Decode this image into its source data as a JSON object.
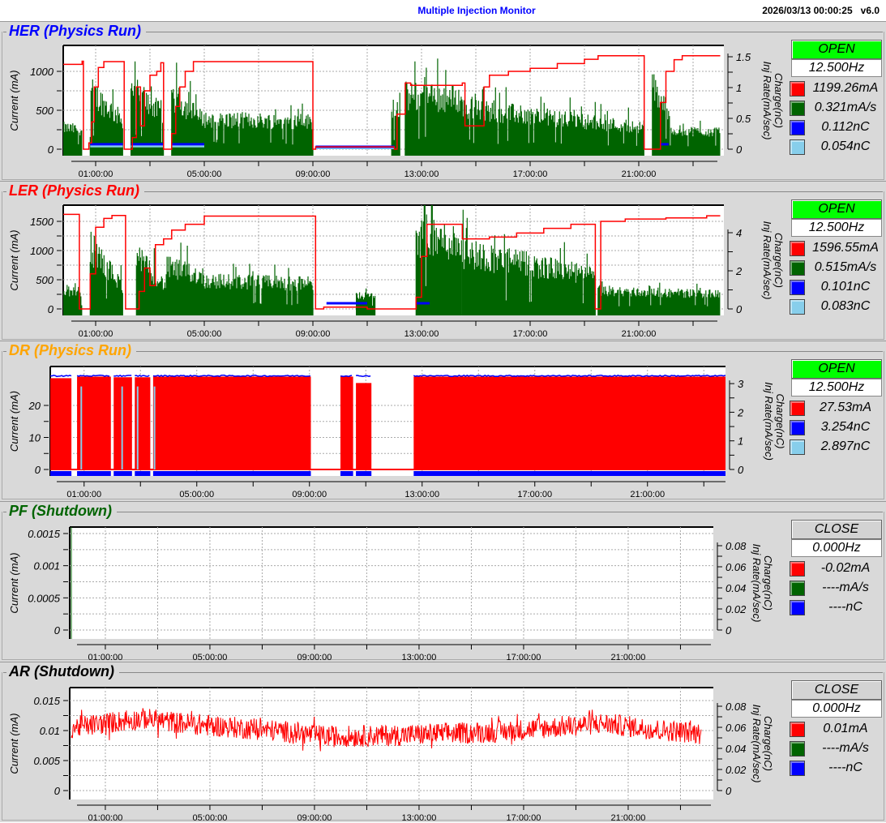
{
  "header": {
    "title": "Multiple Injection Monitor",
    "timestamp": "2026/03/13 00:00:25",
    "version": "v6.0"
  },
  "axis_labels": {
    "left": "Current (mA)",
    "right_charge": "Charge(nC)",
    "right_rate": "Inj Rate(mA/sec)"
  },
  "time_ticks": [
    "01:00:00",
    "05:00:00",
    "09:00:00",
    "13:00:00",
    "17:00:00",
    "21:00:00"
  ],
  "colors": {
    "current": "#ff0000",
    "inj_rate": "#006400",
    "charge1": "#0000ff",
    "charge2": "#87ceeb",
    "open": "#00ff00",
    "close": "#d3d3d3"
  },
  "panels": [
    {
      "id": "HER",
      "title": "HER  (Physics Run)",
      "title_color": "#0000ff",
      "status": "OPEN",
      "rate": "12.500Hz",
      "legend": [
        {
          "color": "#ff0000",
          "value": "1199.26mA"
        },
        {
          "color": "#006400",
          "value": "0.321mA/s"
        },
        {
          "color": "#0000ff",
          "value": "0.112nC"
        },
        {
          "color": "#87ceeb",
          "value": "0.054nC"
        }
      ]
    },
    {
      "id": "LER",
      "title": "LER  (Physics Run)",
      "title_color": "#ff0000",
      "status": "OPEN",
      "rate": "12.500Hz",
      "legend": [
        {
          "color": "#ff0000",
          "value": "1596.55mA"
        },
        {
          "color": "#006400",
          "value": "0.515mA/s"
        },
        {
          "color": "#0000ff",
          "value": "0.101nC"
        },
        {
          "color": "#87ceeb",
          "value": "0.083nC"
        }
      ]
    },
    {
      "id": "DR",
      "title": "DR  (Physics Run)",
      "title_color": "#ffa500",
      "status": "OPEN",
      "rate": "12.500Hz",
      "legend": [
        {
          "color": "#ff0000",
          "value": "27.53mA"
        },
        {
          "color": "#0000ff",
          "value": "3.254nC"
        },
        {
          "color": "#87ceeb",
          "value": "2.897nC"
        }
      ]
    },
    {
      "id": "PF",
      "title": "PF  (Shutdown)",
      "title_color": "#006400",
      "status": "CLOSE",
      "rate": "0.000Hz",
      "legend": [
        {
          "color": "#ff0000",
          "value": "-0.02mA"
        },
        {
          "color": "#006400",
          "value": "----mA/s"
        },
        {
          "color": "#0000ff",
          "value": "----nC"
        }
      ]
    },
    {
      "id": "AR",
      "title": "AR  (Shutdown)",
      "title_color": "#000000",
      "status": "CLOSE",
      "rate": "0.000Hz",
      "legend": [
        {
          "color": "#ff0000",
          "value": "0.01mA"
        },
        {
          "color": "#006400",
          "value": "----mA/s"
        },
        {
          "color": "#0000ff",
          "value": "----nC"
        }
      ]
    }
  ],
  "chart_data": [
    {
      "id": "HER",
      "type": "line",
      "x_unit": "hours",
      "xlim": [
        -0.2,
        24
      ],
      "left_ticks": [
        "0",
        "500",
        "1000"
      ],
      "left_tick_values": [
        0,
        500,
        1000
      ],
      "left_minor": 250,
      "right_ticks": [
        "0",
        "0.5",
        "1",
        "1.5"
      ],
      "right_tick_values": [
        0,
        0.5,
        1,
        1.5
      ],
      "right_minor": 0.25,
      "current_steps": [
        [
          -0.2,
          1090
        ],
        [
          0.5,
          1130
        ],
        [
          0.55,
          0
        ],
        [
          0.75,
          80
        ],
        [
          0.85,
          350
        ],
        [
          0.95,
          800
        ],
        [
          1.1,
          1050
        ],
        [
          1.3,
          1125
        ],
        [
          2.05,
          0
        ],
        [
          2.35,
          150
        ],
        [
          2.5,
          800
        ],
        [
          2.65,
          300
        ],
        [
          2.8,
          750
        ],
        [
          3.0,
          950
        ],
        [
          3.25,
          1000
        ],
        [
          3.4,
          1110
        ],
        [
          3.5,
          0
        ],
        [
          3.8,
          200
        ],
        [
          3.95,
          550
        ],
        [
          4.1,
          800
        ],
        [
          4.3,
          1000
        ],
        [
          4.6,
          1125
        ],
        [
          9.0,
          0
        ],
        [
          9.1,
          30
        ],
        [
          12.0,
          0
        ],
        [
          12.1,
          450
        ],
        [
          12.4,
          850
        ],
        [
          12.6,
          820
        ],
        [
          14.5,
          850
        ],
        [
          14.6,
          300
        ],
        [
          15.3,
          800
        ],
        [
          15.5,
          950
        ],
        [
          16.2,
          1000
        ],
        [
          17.0,
          1040
        ],
        [
          18.0,
          1100
        ],
        [
          19.0,
          1155
        ],
        [
          19.5,
          1200
        ],
        [
          21.2,
          0
        ],
        [
          21.8,
          600
        ],
        [
          22.0,
          1000
        ],
        [
          22.3,
          1150
        ],
        [
          22.6,
          1200
        ],
        [
          24,
          1200
        ]
      ],
      "inj_rate_segments": [
        [
          -0.2,
          0.5,
          0.45,
          0.4
        ],
        [
          0.8,
          2.0,
          1.2,
          0.6
        ],
        [
          2.3,
          3.5,
          1.3,
          0.7
        ],
        [
          3.8,
          5.0,
          1.1,
          0.6
        ],
        [
          5.0,
          9.0,
          0.62,
          0.58
        ],
        [
          11.9,
          12.2,
          0.9,
          0.9
        ],
        [
          12.4,
          14.5,
          1.1,
          1.05
        ],
        [
          14.5,
          21.2,
          0.85,
          0.45
        ],
        [
          21.5,
          22.1,
          1.3,
          0.8
        ],
        [
          22.1,
          24,
          0.4,
          0.35
        ]
      ],
      "charge1_segments": [
        [
          0.8,
          2.0,
          0.08
        ],
        [
          2.3,
          3.5,
          0.08
        ],
        [
          3.8,
          5.0,
          0.08
        ],
        [
          9.1,
          12.0,
          0.04
        ],
        [
          21.8,
          22.1,
          0.08
        ]
      ],
      "charge2_segments": [
        [
          0.8,
          2.0,
          0.05
        ],
        [
          2.3,
          3.5,
          0.05
        ],
        [
          3.8,
          5.0,
          0.05
        ],
        [
          9.1,
          12.0,
          0.02
        ]
      ]
    },
    {
      "id": "LER",
      "type": "line",
      "x_unit": "hours",
      "xlim": [
        -0.2,
        24
      ],
      "left_ticks": [
        "0",
        "500",
        "1000",
        "1500"
      ],
      "left_tick_values": [
        0,
        500,
        1000,
        1500
      ],
      "left_minor": 250,
      "right_ticks": [
        "0",
        "2",
        "4"
      ],
      "right_tick_values": [
        0,
        2,
        4
      ],
      "right_minor": 1,
      "current_steps": [
        [
          -0.2,
          1620
        ],
        [
          0.4,
          0
        ],
        [
          0.8,
          600
        ],
        [
          1.0,
          1400
        ],
        [
          1.3,
          1550
        ],
        [
          1.6,
          1600
        ],
        [
          2.1,
          0
        ],
        [
          2.6,
          300
        ],
        [
          2.8,
          700
        ],
        [
          3.0,
          400
        ],
        [
          3.2,
          1100
        ],
        [
          3.5,
          1200
        ],
        [
          3.8,
          1350
        ],
        [
          4.3,
          1450
        ],
        [
          5.0,
          1590
        ],
        [
          9.1,
          0
        ],
        [
          9.4,
          30
        ],
        [
          11.0,
          0
        ],
        [
          12.8,
          200
        ],
        [
          13.0,
          900
        ],
        [
          13.2,
          1450
        ],
        [
          14.5,
          1200
        ],
        [
          15.5,
          1230
        ],
        [
          16.5,
          1300
        ],
        [
          17.5,
          1380
        ],
        [
          18.5,
          1450
        ],
        [
          19.4,
          0
        ],
        [
          19.6,
          1500
        ],
        [
          20.5,
          1540
        ],
        [
          22,
          1560
        ],
        [
          23.5,
          1596
        ],
        [
          24,
          1596
        ]
      ],
      "inj_rate_segments": [
        [
          -0.2,
          0.5,
          1.3,
          1.0
        ],
        [
          0.8,
          2.0,
          4.2,
          1.5
        ],
        [
          2.5,
          3.6,
          3.5,
          1.5
        ],
        [
          3.6,
          5.0,
          2.8,
          2.2
        ],
        [
          5.0,
          9.0,
          1.9,
          1.7
        ],
        [
          10.6,
          11.3,
          0.9,
          0.9
        ],
        [
          12.8,
          14.5,
          4.8,
          4.5
        ],
        [
          14.5,
          19.4,
          3.8,
          2.2
        ],
        [
          19.5,
          24,
          1.2,
          1.0
        ]
      ],
      "charge1_segments": [
        [
          9.5,
          11.0,
          0.3
        ],
        [
          12.8,
          13.3,
          0.3
        ]
      ],
      "charge2_segments": []
    },
    {
      "id": "DR",
      "type": "area",
      "x_unit": "hours",
      "xlim": [
        -0.2,
        24
      ],
      "left_ticks": [
        "0",
        "10",
        "20"
      ],
      "left_tick_values": [
        0,
        10,
        20
      ],
      "left_minor": 5,
      "right_ticks": [
        "0",
        "1",
        "2",
        "3"
      ],
      "right_tick_values": [
        0,
        1,
        2,
        3
      ],
      "right_minor": 0.5,
      "current_fill_segments": [
        [
          -0.2,
          0.55,
          28.5
        ],
        [
          0.75,
          1.95,
          29
        ],
        [
          2.05,
          2.7,
          28.8
        ],
        [
          2.8,
          3.35,
          28.8
        ],
        [
          3.45,
          9.05,
          29
        ],
        [
          10.1,
          10.55,
          29
        ],
        [
          10.65,
          11.2,
          27
        ],
        [
          12.7,
          24,
          29
        ]
      ],
      "charge1_top": 3.25,
      "charge2_top": 2.9
    },
    {
      "id": "PF",
      "type": "line",
      "x_unit": "hours",
      "xlim": [
        -0.3,
        24
      ],
      "left_ticks": [
        "0",
        "0.0005",
        "0.001",
        "0.0015"
      ],
      "left_tick_values": [
        0,
        0.0005,
        0.001,
        0.0015
      ],
      "left_minor": 0.00025,
      "right_ticks": [
        "0",
        "0.02",
        "0.04",
        "0.06",
        "0.08"
      ],
      "right_tick_values": [
        0,
        0.02,
        0.04,
        0.06,
        0.08
      ],
      "right_minor": 0.01,
      "noise_baseline": []
    },
    {
      "id": "AR",
      "type": "line",
      "x_unit": "hours",
      "xlim": [
        -0.3,
        24
      ],
      "left_ticks": [
        "0",
        "0.005",
        "0.01",
        "0.015"
      ],
      "left_tick_values": [
        0,
        0.005,
        0.01,
        0.015
      ],
      "left_minor": 0.0025,
      "right_ticks": [
        "0",
        "0.02",
        "0.04",
        "0.06",
        "0.08"
      ],
      "right_tick_values": [
        0,
        0.02,
        0.04,
        0.06,
        0.08
      ],
      "right_minor": 0.01,
      "noise_baseline": [
        [
          -0.3,
          0.0105
        ],
        [
          1.5,
          0.0115
        ],
        [
          2.5,
          0.012
        ],
        [
          4,
          0.0112
        ],
        [
          6,
          0.0105
        ],
        [
          8,
          0.0098
        ],
        [
          9.5,
          0.009
        ],
        [
          12,
          0.0092
        ],
        [
          14,
          0.0095
        ],
        [
          16,
          0.0098
        ],
        [
          18,
          0.0105
        ],
        [
          20,
          0.0112
        ],
        [
          22,
          0.0102
        ],
        [
          23.8,
          0.0095
        ]
      ],
      "noise_amplitude": 0.0018
    }
  ]
}
